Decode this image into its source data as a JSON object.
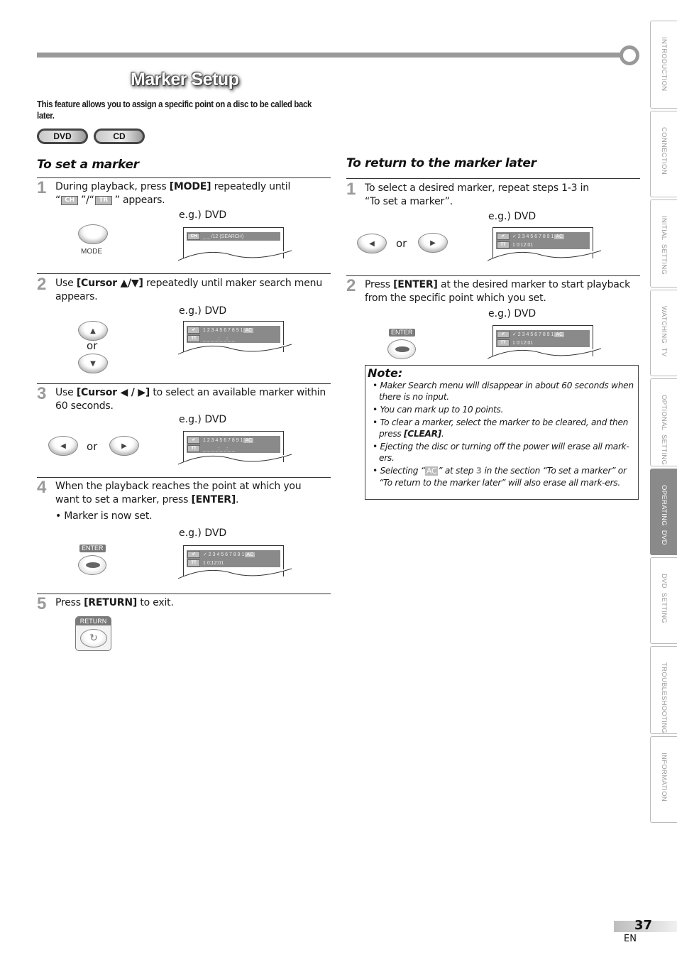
{
  "header": {
    "title": "Marker Setup",
    "intro": "This feature allows you to assign a specific point on a disc to be called back later.",
    "badges": [
      "DVD",
      "CD"
    ]
  },
  "set_marker": {
    "heading": "To set a marker",
    "steps": [
      {
        "num": "1",
        "text_parts": [
          "During playback, press ",
          "[MODE]",
          " repeatedly until",
          "“",
          "CH",
          "”/“",
          "TR",
          "” appears."
        ],
        "example_label": "e.g.) DVD",
        "button_label": "MODE",
        "osd": {
          "tag": "CH",
          "text": "_ _ /12   (SEARCH)"
        }
      },
      {
        "num": "2",
        "text_parts": [
          "Use ",
          "[Cursor ▲/▼]",
          " repeatedly until maker search menu appears."
        ],
        "example_label": "e.g.) DVD",
        "or_label": "or",
        "up_icon": "▲",
        "down_icon": "▼",
        "osd": {
          "tag1": "✔",
          "row1": "1 2 3 4 5 6 7 8 9 1",
          "ac": "AC",
          "tag2": "TT",
          "row2": "_ _  _ _:_ _:_ _"
        }
      },
      {
        "num": "3",
        "text_parts": [
          "Use ",
          "[Cursor ◀ / ▶]",
          " to select an available marker within 60 seconds."
        ],
        "example_label": "e.g.) DVD",
        "or_label": "or",
        "left_icon": "◀",
        "right_icon": "▶",
        "osd": {
          "tag1": "✔",
          "row1": "1 2 3 4 5 6 7 8 9 1",
          "ac": "AC",
          "tag2": "TT",
          "row2": "_ _  _ _:_ _:_ _"
        }
      },
      {
        "num": "4",
        "text_parts": [
          "When the playback reaches the point at which you want to set a marker, press ",
          "[ENTER]",
          "."
        ],
        "bullet": "• Marker is now set.",
        "example_label": "e.g.) DVD",
        "button_label": "ENTER",
        "osd": {
          "tag1": "✔",
          "row1": "✓ 2 3 4 5 6 7 8 9 1",
          "ac": "AC",
          "tag2": "TT",
          "row2": "1  0:12:01"
        }
      },
      {
        "num": "5",
        "text_parts": [
          "Press ",
          "[RETURN]",
          " to exit."
        ],
        "button_label": "RETURN",
        "button_icon": "↻"
      }
    ]
  },
  "return_marker": {
    "heading": "To return to the marker later",
    "steps": [
      {
        "num": "1",
        "text": "To select a desired marker, repeat steps 1-3 in “To set a marker”.",
        "example_label": "e.g.) DVD",
        "or_label": "or",
        "left_icon": "◀",
        "right_icon": "▶",
        "osd": {
          "tag1": "✔",
          "row1": "✓ 2 3 4 5 6 7 8 9 1",
          "ac": "AC",
          "tag2": "TT",
          "row2": "1  0:12:01"
        }
      },
      {
        "num": "2",
        "text_parts": [
          "Press ",
          "[ENTER]",
          " at the desired marker to start playback from the specific point which you set."
        ],
        "example_label": "e.g.) DVD",
        "button_label": "ENTER",
        "osd": {
          "tag1": "✔",
          "row1": "✓ 2 3 4 5 6 7 8 9 1",
          "ac": "AC",
          "tag2": "TT",
          "row2": "1  0:12:01"
        }
      }
    ]
  },
  "note": {
    "title": "Note:",
    "items": [
      "Maker Search menu will disappear in about 60 seconds when there is no input.",
      "You can mark up to 10 points.",
      {
        "before": "To clear a marker, select the marker to be cleared, and then press ",
        "bold": "[CLEAR]",
        "after": "."
      },
      "Ejecting the disc or turning off the power will erase all mark-ers.",
      {
        "before": "Selecting “",
        "tag": "AC",
        "mid": "” at step ",
        "step": "3",
        "after": " in the section “To set a marker” or “To return to the marker later” will also erase all mark-ers."
      }
    ]
  },
  "side_tabs": [
    {
      "label": "INTRODUCTION",
      "active": false
    },
    {
      "label": "CONNECTION",
      "active": false
    },
    {
      "label": "INITIAL  SETTING",
      "active": false
    },
    {
      "label": "WATCHING  TV",
      "active": false
    },
    {
      "label": "OPTIONAL  SETTING",
      "active": false
    },
    {
      "label": "OPERATING  DVD",
      "active": true
    },
    {
      "label": "DVD  SETTING",
      "active": false
    },
    {
      "label": "TROUBLESHOOTING",
      "active": false
    },
    {
      "label": "INFORMATION",
      "active": false
    }
  ],
  "footer": {
    "page_number": "37",
    "language": "EN"
  },
  "colors": {
    "accent_gray": "#8a8a8a",
    "step_number": "#9a9a9a"
  }
}
